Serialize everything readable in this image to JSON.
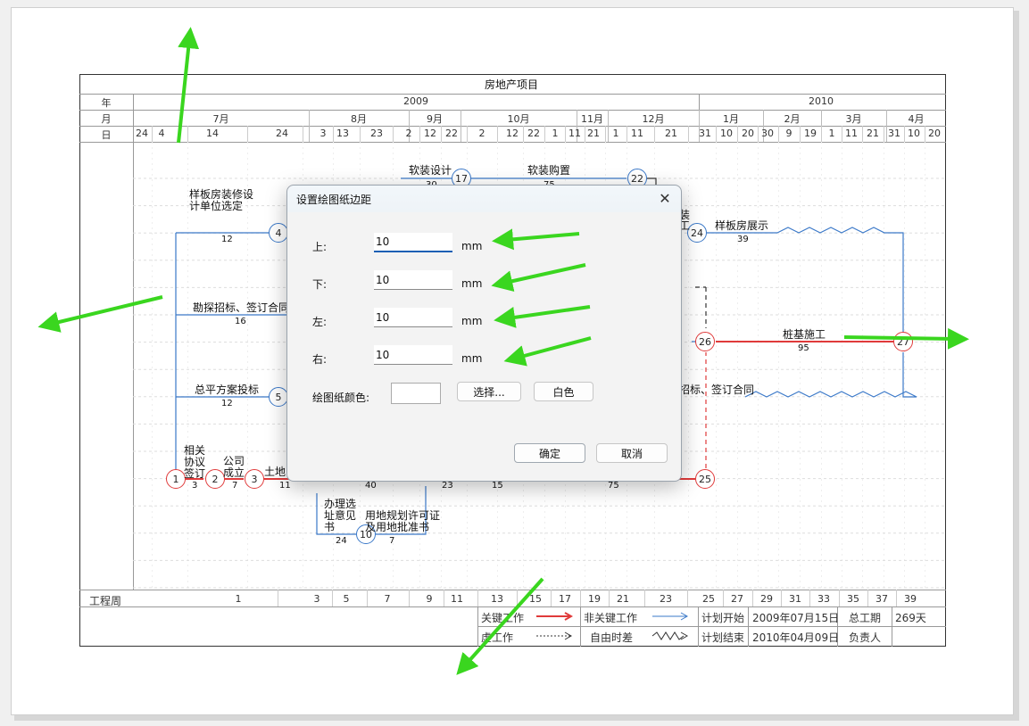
{
  "project_title": "房地产项目",
  "header": {
    "row_labels": {
      "year": "年",
      "month": "月",
      "day": "日"
    },
    "years": [
      "2009",
      "2010"
    ],
    "months": [
      "7月",
      "8月",
      "9月",
      "10月",
      "11月",
      "12月",
      "1月",
      "2月",
      "3月",
      "4月"
    ],
    "days": [
      "24",
      "4",
      "14",
      "24",
      "3",
      "13",
      "23",
      "2",
      "12",
      "22",
      "2",
      "12",
      "22",
      "1",
      "11",
      "21",
      "1",
      "11",
      "21",
      "31",
      "10",
      "20",
      "30",
      "9",
      "19",
      "1",
      "11",
      "21",
      "31",
      "10",
      "20"
    ]
  },
  "week_row": {
    "label": "工程周",
    "values": [
      "1",
      "3",
      "5",
      "7",
      "9",
      "11",
      "13",
      "15",
      "17",
      "19",
      "21",
      "23",
      "25",
      "27",
      "29",
      "31",
      "33",
      "35",
      "37",
      "39"
    ]
  },
  "network": {
    "nodes": [
      "1",
      "2",
      "3",
      "4",
      "5",
      "10",
      "17",
      "22",
      "24",
      "25",
      "26",
      "27"
    ],
    "task_labels": [
      "样板房装修设计单位选定",
      "12",
      "软装设计",
      "软装购置",
      "样板房展示",
      "39",
      "勘探招标、签订合同",
      "16",
      "总平方案投标",
      "12",
      "桩基施工",
      "95",
      "招标、签订合同",
      "相关协议签订",
      "3",
      "公司成立",
      "7",
      "土地",
      "11",
      "40",
      "23",
      "15",
      "75",
      "办理选址意见书",
      "24",
      "用地规划许可证及用地批准书",
      "7",
      "30",
      "75",
      "装",
      "工"
    ]
  },
  "legend": {
    "critical": "关键工作",
    "noncritical": "非关键工作",
    "virtual": "虚工作",
    "free_float": "自由时差",
    "plan_start_label": "计划开始",
    "plan_start": "2009年07月15日",
    "plan_end_label": "计划结束",
    "plan_end": "2010年04月09日",
    "duration_label": "总工期",
    "duration": "269天",
    "owner_label": "负责人",
    "owner": ""
  },
  "dialog": {
    "title": "设置绘图纸边距",
    "top_label": "上:",
    "top_value": "10",
    "bottom_label": "下:",
    "bottom_value": "10",
    "left_label": "左:",
    "left_value": "10",
    "right_label": "右:",
    "right_value": "10",
    "unit": "mm",
    "color_label": "绘图纸颜色:",
    "choose_button": "选择...",
    "white_button": "白色",
    "ok_button": "确定",
    "cancel_button": "取消",
    "close_icon": "close-icon"
  },
  "colors": {
    "critical": "#e03a3a",
    "noncritical": "#3a78c8",
    "annotation_arrow": "#3ad61f",
    "accent": "#1a5fb4"
  }
}
